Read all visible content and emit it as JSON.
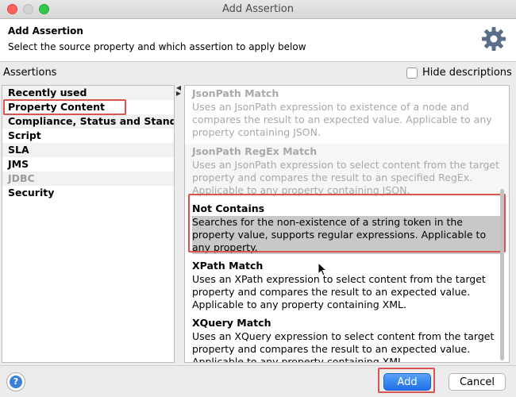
{
  "window": {
    "title": "Add Assertion"
  },
  "header": {
    "title": "Add Assertion",
    "subtitle": "Select the source property and which assertion to apply below"
  },
  "assertions_label": "Assertions",
  "hide_descriptions": {
    "label": "Hide descriptions",
    "checked": false
  },
  "categories": [
    {
      "label": "Recently used",
      "enabled": true
    },
    {
      "label": "Property Content",
      "enabled": true,
      "selected": true
    },
    {
      "label": "Compliance, Status and Stand…",
      "enabled": true
    },
    {
      "label": "Script",
      "enabled": true
    },
    {
      "label": "SLA",
      "enabled": true
    },
    {
      "label": "JMS",
      "enabled": true
    },
    {
      "label": "JDBC",
      "enabled": false
    },
    {
      "label": "Security",
      "enabled": true
    }
  ],
  "assertions": [
    {
      "name": "JsonPath Match",
      "description": "Uses an JsonPath expression to existence of a node and compares the result to an expected value. Applicable to any property containing JSON.",
      "enabled": false
    },
    {
      "name": "JsonPath RegEx Match",
      "description": "Uses an JsonPath expression to select content from the target property and compares the result to an specified RegEx. Applicable to any property containing JSON.",
      "enabled": false
    },
    {
      "name": "Not Contains",
      "description": "Searches for the non-existence of a string token in the property value, supports regular expressions. Applicable to any property.",
      "enabled": true,
      "selected": true
    },
    {
      "name": "XPath Match",
      "description": "Uses an XPath expression to select content from the target property and compares the result to an expected value. Applicable to any property containing XML.",
      "enabled": true
    },
    {
      "name": "XQuery Match",
      "description": "Uses an XQuery expression to select content from the target property and compares the result to an expected value. Applicable to any property containing XML.",
      "enabled": true
    }
  ],
  "buttons": {
    "help": "?",
    "add": "Add",
    "cancel": "Cancel"
  },
  "colors": {
    "accent": "#1d6fe6",
    "highlight": "#d9534f",
    "selection": "#c8c8c8"
  }
}
